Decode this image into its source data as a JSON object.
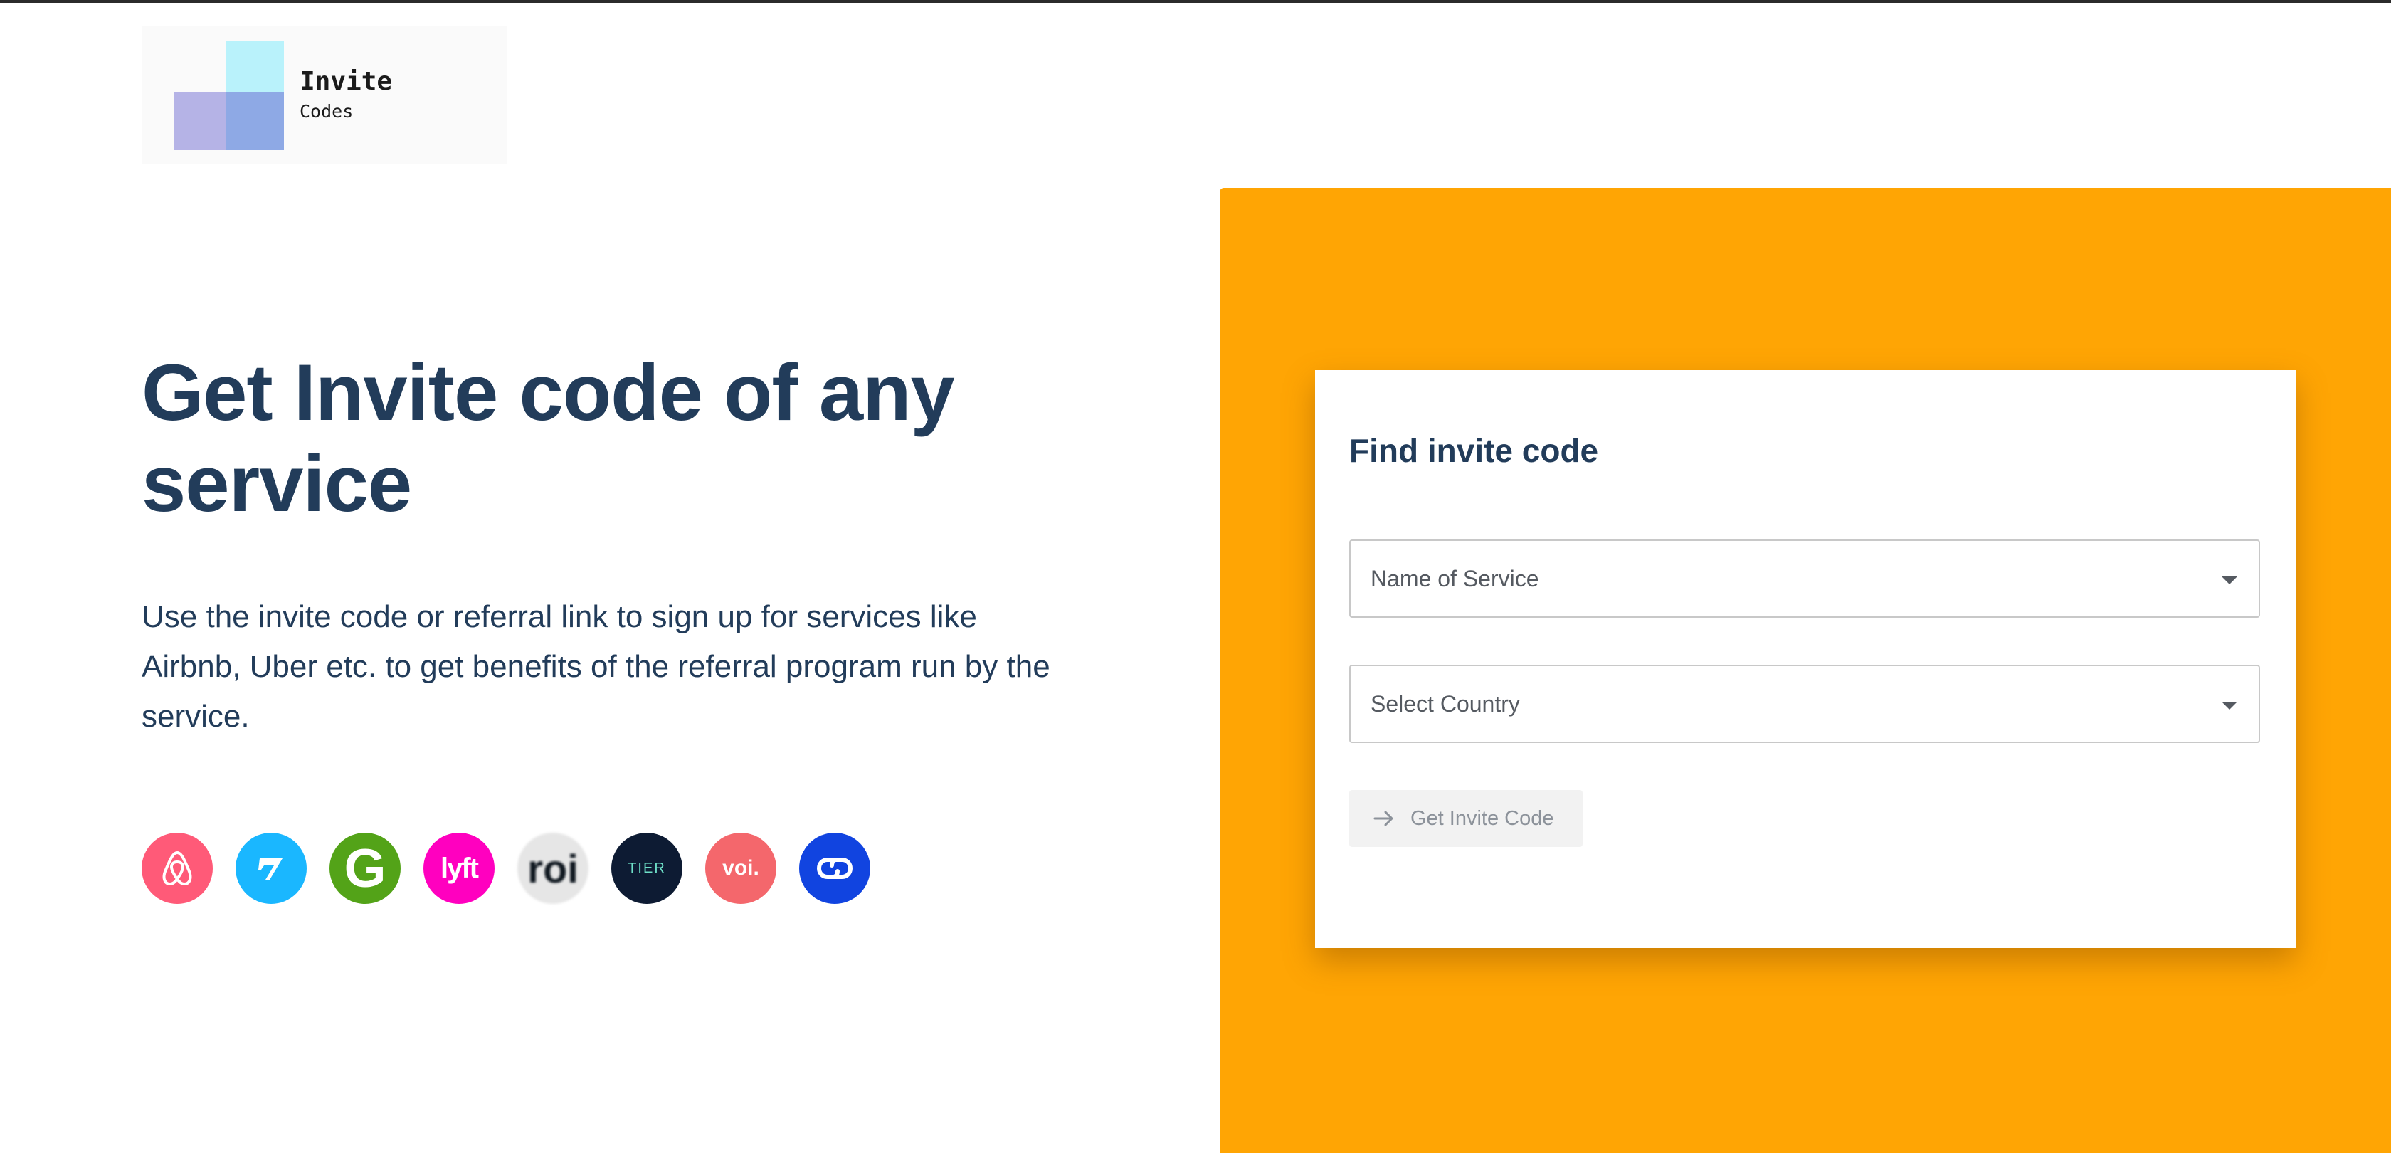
{
  "logo": {
    "title": "Invite",
    "subtitle": "Codes"
  },
  "hero": {
    "title": "Get Invite code of any service",
    "description": "Use the invite code or referral link to sign up for services like Airbnb, Uber etc. to get benefits of the referral program run by the service."
  },
  "services": [
    {
      "name": "airbnb",
      "color": "#ff5a78",
      "label": ""
    },
    {
      "name": "wise",
      "color": "#1ab7ff",
      "label": ""
    },
    {
      "name": "groupon",
      "color": "#53a318",
      "label": "G"
    },
    {
      "name": "lyft",
      "color": "#ff00bf",
      "label": "lyft"
    },
    {
      "name": "roi",
      "color": "#e6e6e6",
      "label": "roi"
    },
    {
      "name": "tier",
      "color": "#0d1b33",
      "label": "TIER"
    },
    {
      "name": "voi",
      "color": "#f4676c",
      "label": "voi."
    },
    {
      "name": "curve",
      "color": "#1144e0",
      "label": ""
    }
  ],
  "panel": {
    "accent": "#ffa504"
  },
  "form": {
    "title": "Find invite code",
    "service_placeholder": "Name of Service",
    "country_placeholder": "Select Country",
    "submit_label": "Get Invite Code"
  }
}
